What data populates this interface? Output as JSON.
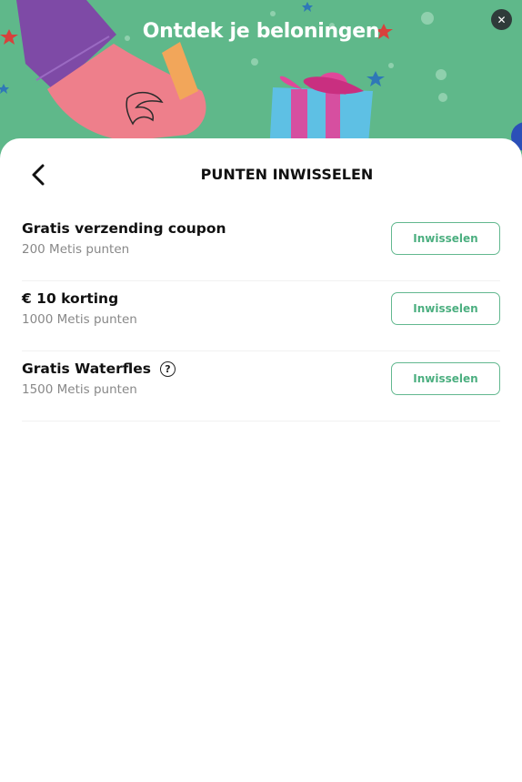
{
  "banner": {
    "title": "Ontdek je beloningen",
    "close_label": "✕",
    "bg_color": "#5fb88a"
  },
  "panel": {
    "title": "PUNTEN INWISSELEN",
    "back_icon": "chevron-left-icon"
  },
  "rewards": [
    {
      "title": "Gratis verzending coupon",
      "points": "200 Metis punten",
      "button": "Inwisselen",
      "help": false
    },
    {
      "title": "€ 10 korting",
      "points": "1000 Metis punten",
      "button": "Inwisselen",
      "help": false
    },
    {
      "title": "Gratis Waterfles",
      "points": "1500 Metis punten",
      "button": "Inwisselen",
      "help": true,
      "help_label": "?"
    }
  ],
  "accent_color": "#4caf80"
}
